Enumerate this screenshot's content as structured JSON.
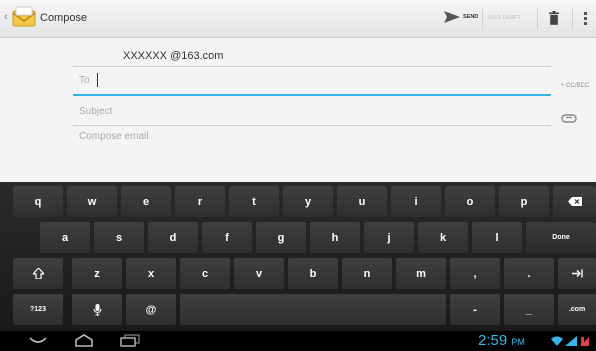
{
  "action_bar": {
    "up_caret": "‹",
    "title": "Compose",
    "send_label": "SEND",
    "save_draft_label": "SAVE DRAFT",
    "icons": [
      "email-app-icon",
      "send-icon",
      "trash-icon",
      "overflow-menu-icon"
    ],
    "accent": "#33b5e5"
  },
  "compose": {
    "from": "XXXXXX @163.com",
    "to_label": "To",
    "cc_bcc_label": "+ CC/BCC",
    "subject_placeholder": "Subject",
    "body_placeholder": "Compose email"
  },
  "keyboard": {
    "row1": [
      "q",
      "w",
      "e",
      "r",
      "t",
      "y",
      "u",
      "i",
      "o",
      "p"
    ],
    "row2": [
      "a",
      "s",
      "d",
      "f",
      "g",
      "h",
      "j",
      "k",
      "l"
    ],
    "row3": [
      "z",
      "x",
      "c",
      "v",
      "b",
      "n",
      "m",
      ",",
      "."
    ],
    "done_label": "Done",
    "symbols_label": "?123",
    "at_label": "@",
    "dash_label": "-",
    "underscore_label": "_",
    "com_label": ".com",
    "icons": [
      "backspace-icon",
      "shift-icon",
      "tab-icon",
      "microphone-icon"
    ]
  },
  "status_bar": {
    "time": "2:59",
    "ampm": "PM",
    "icons": [
      "back-icon",
      "home-icon",
      "recent-apps-icon",
      "wifi-icon",
      "signal-icon",
      "battery-icon"
    ]
  }
}
